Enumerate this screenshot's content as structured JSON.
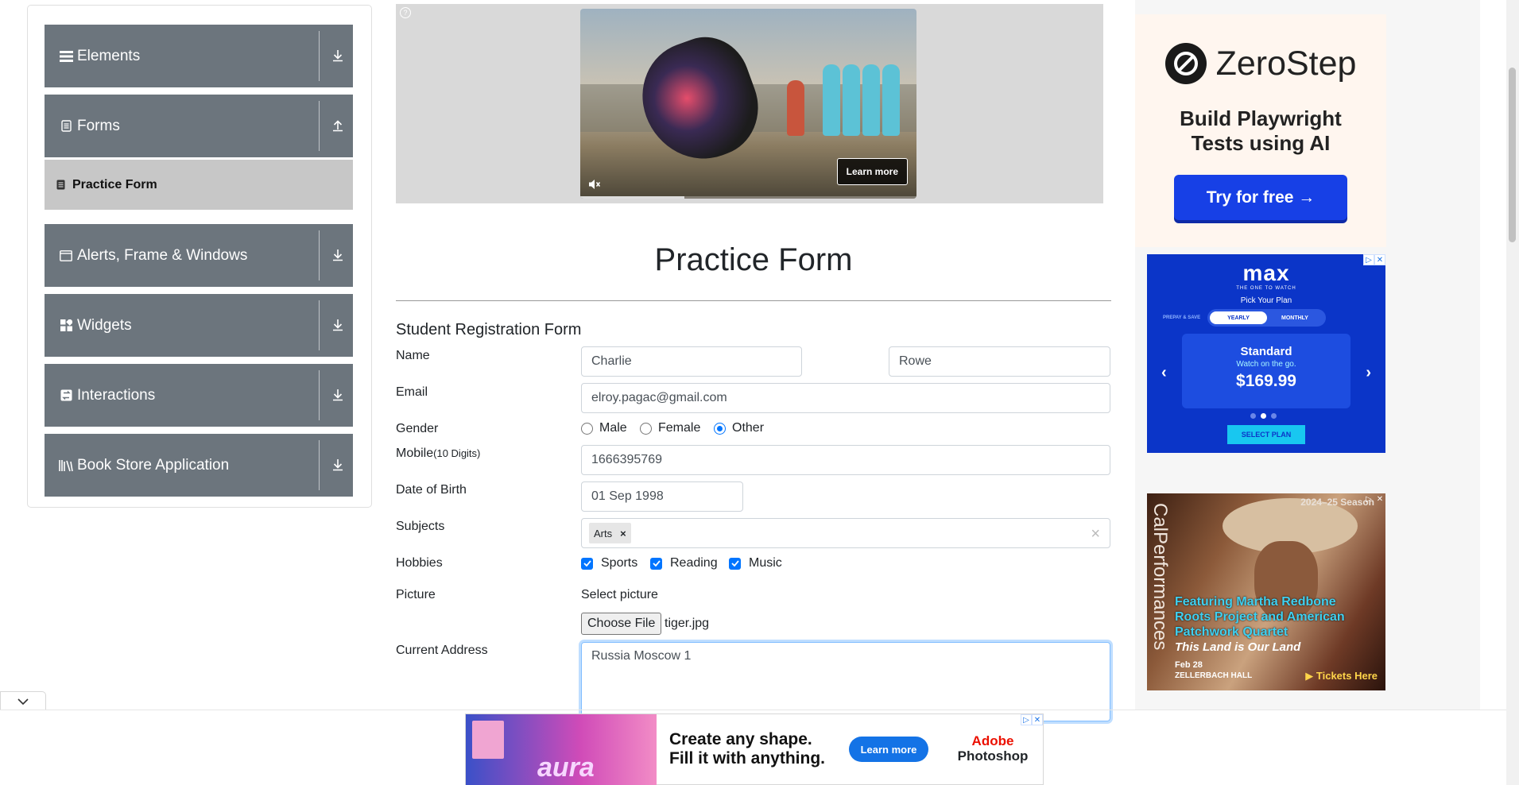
{
  "sidebar": {
    "groups": [
      {
        "label": "Elements",
        "icon": "hamburger-icon"
      },
      {
        "label": "Forms",
        "icon": "document-icon"
      },
      {
        "label": "Alerts, Frame & Windows",
        "icon": "window-icon"
      },
      {
        "label": "Widgets",
        "icon": "widgets-icon"
      },
      {
        "label": "Interactions",
        "icon": "interactions-icon"
      },
      {
        "label": "Book Store Application",
        "icon": "books-icon"
      }
    ],
    "active_item": "Practice Form"
  },
  "video_ad": {
    "learn_more": "Learn more",
    "progress": 0.31
  },
  "form": {
    "page_title": "Practice Form",
    "subtitle": "Student Registration Form",
    "name_label": "Name",
    "first_name": "Charlie",
    "last_name": "Rowe",
    "email_label": "Email",
    "email": "elroy.pagac@gmail.com",
    "gender_label": "Gender",
    "genders": [
      "Male",
      "Female",
      "Other"
    ],
    "gender_selected": "Other",
    "mobile_label": "Mobile",
    "mobile_hint": "(10 Digits)",
    "mobile": "1666395769",
    "dob_label": "Date of Birth",
    "dob": "01 Sep 1998",
    "subjects_label": "Subjects",
    "subject_chip": "Arts",
    "chip_remove": "×",
    "subjects_clear": "×",
    "hobbies_label": "Hobbies",
    "hobbies": [
      "Sports",
      "Reading",
      "Music"
    ],
    "picture_label": "Picture",
    "select_picture": "Select picture",
    "choose_file": "Choose File",
    "file_name": "tiger.jpg",
    "address_label": "Current Address",
    "address": "Russia Moscow 1"
  },
  "ads": {
    "zerostep": {
      "brand": "ZeroStep",
      "headline": "Build Playwright Tests using AI",
      "cta": "Try for free →",
      "colors": {
        "button": "#1740e6"
      }
    },
    "max": {
      "logo": "max",
      "tagline": "THE ONE TO WATCH",
      "pick": "Pick Your Plan",
      "prepay": "PREPAY & SAVE",
      "yearly": "YEARLY",
      "monthly": "MONTHLY",
      "plan": "Standard",
      "watch": "Watch on the go.",
      "price": "$169.99",
      "cta": "SELECT PLAN",
      "prev": "‹",
      "next": "›"
    },
    "calperformances": {
      "season": "2024–25 Season",
      "brand": "CalPerformances",
      "feature": "Featuring Martha Redbone Roots Project and American Patchwork Quartet",
      "title": "This Land is Our Land",
      "date": "Feb 28",
      "venue": "ZELLERBACH HALL",
      "cta": "▶ Tickets Here"
    },
    "adobe": {
      "art_word": "aura",
      "headline_line1": "Create any shape.",
      "headline_line2": "Fill it with anything.",
      "cta": "Learn more",
      "brand_line1": "Adobe",
      "brand_line2": "Photoshop"
    },
    "ad_choices": "▷",
    "close": "✕"
  }
}
